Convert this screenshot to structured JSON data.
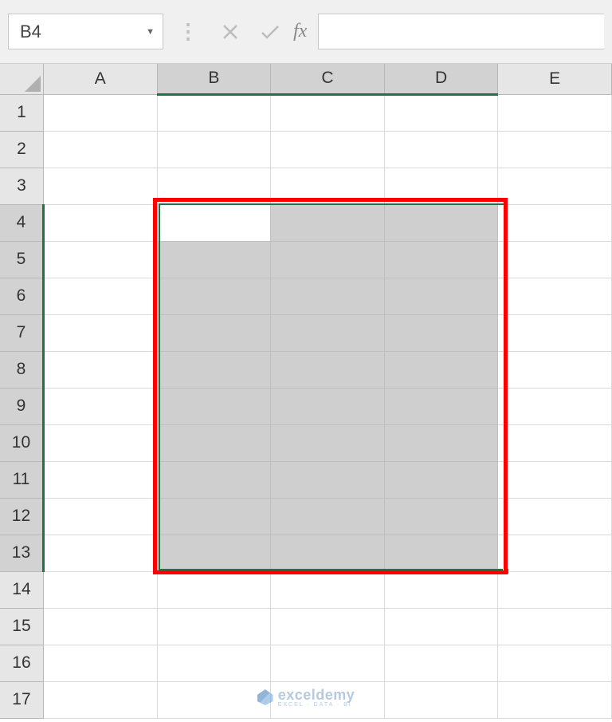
{
  "name_box": {
    "value": "B4"
  },
  "formula_bar": {
    "value": ""
  },
  "fx_label": "fx",
  "columns": [
    {
      "label": "A",
      "selected": false
    },
    {
      "label": "B",
      "selected": true
    },
    {
      "label": "C",
      "selected": true
    },
    {
      "label": "D",
      "selected": true
    },
    {
      "label": "E",
      "selected": false
    }
  ],
  "rows": [
    {
      "label": "1",
      "selected": false
    },
    {
      "label": "2",
      "selected": false
    },
    {
      "label": "3",
      "selected": false
    },
    {
      "label": "4",
      "selected": true
    },
    {
      "label": "5",
      "selected": true
    },
    {
      "label": "6",
      "selected": true
    },
    {
      "label": "7",
      "selected": true
    },
    {
      "label": "8",
      "selected": true
    },
    {
      "label": "9",
      "selected": true
    },
    {
      "label": "10",
      "selected": true
    },
    {
      "label": "11",
      "selected": true
    },
    {
      "label": "12",
      "selected": true
    },
    {
      "label": "13",
      "selected": true
    },
    {
      "label": "14",
      "selected": false
    },
    {
      "label": "15",
      "selected": false
    },
    {
      "label": "16",
      "selected": false
    },
    {
      "label": "17",
      "selected": false
    }
  ],
  "selection": {
    "active": "B4",
    "range": "B4:D13"
  },
  "watermark": {
    "brand": "exceldemy",
    "tagline": "EXCEL · DATA · BI"
  },
  "colors": {
    "excel_green": "#217346",
    "annotation_red": "#ff0000"
  }
}
